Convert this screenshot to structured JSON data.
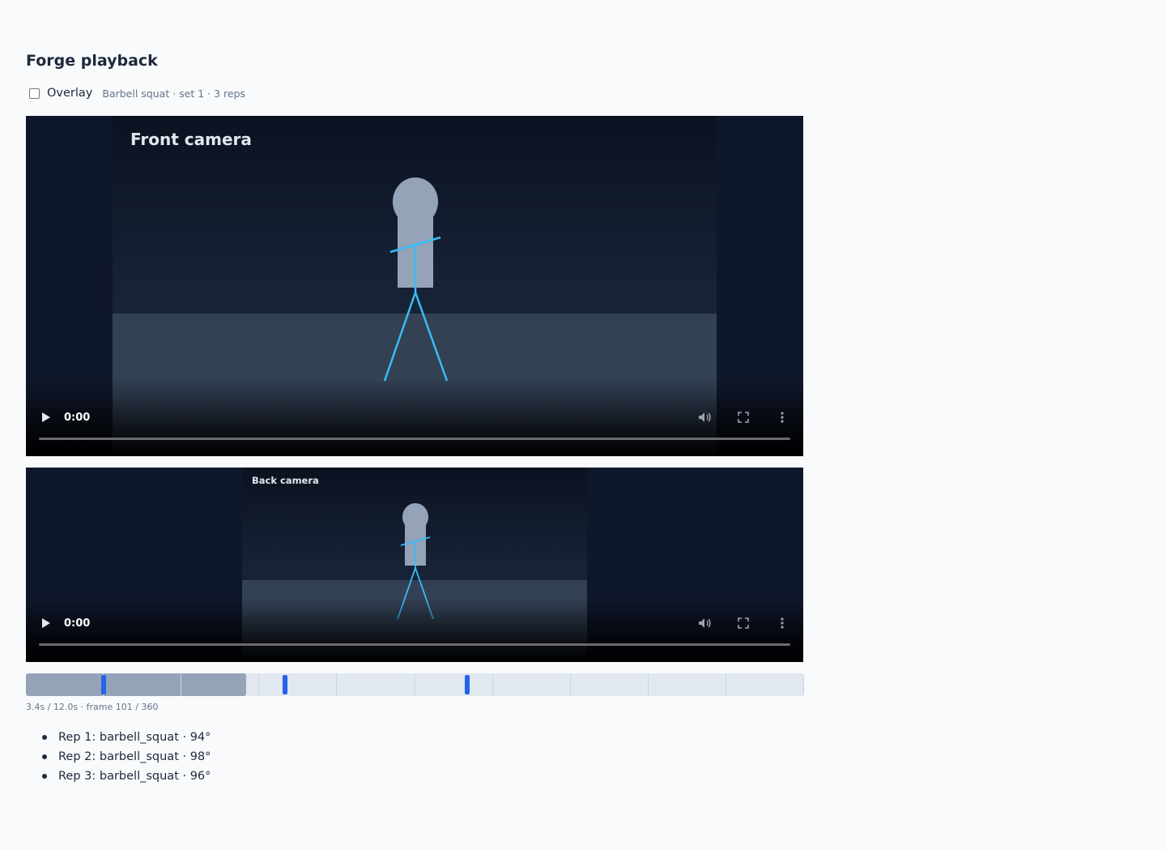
{
  "page": {
    "title": "Forge playback"
  },
  "toolbar": {
    "overlay_label": "Overlay",
    "overlay_checked": false,
    "session_meta": "Barbell squat · set 1 · 3 reps"
  },
  "players": [
    {
      "camera_label": "Front camera",
      "current_time": "0:00"
    },
    {
      "camera_label": "Back camera",
      "current_time": "0:00"
    }
  ],
  "timeline": {
    "progress_fraction": 0.283,
    "tick_count": 10,
    "rep_marker_fractions": [
      0.1,
      0.333,
      0.567
    ],
    "readout": "3.4s / 12.0s · frame 101 / 360"
  },
  "reps": [
    "Rep 1: barbell_squat · 94°",
    "Rep 2: barbell_squat · 98°",
    "Rep 3: barbell_squat · 96°"
  ],
  "colors": {
    "accent": "#2563eb",
    "skeleton": "#38bdf8",
    "body": "#94a3b8"
  }
}
